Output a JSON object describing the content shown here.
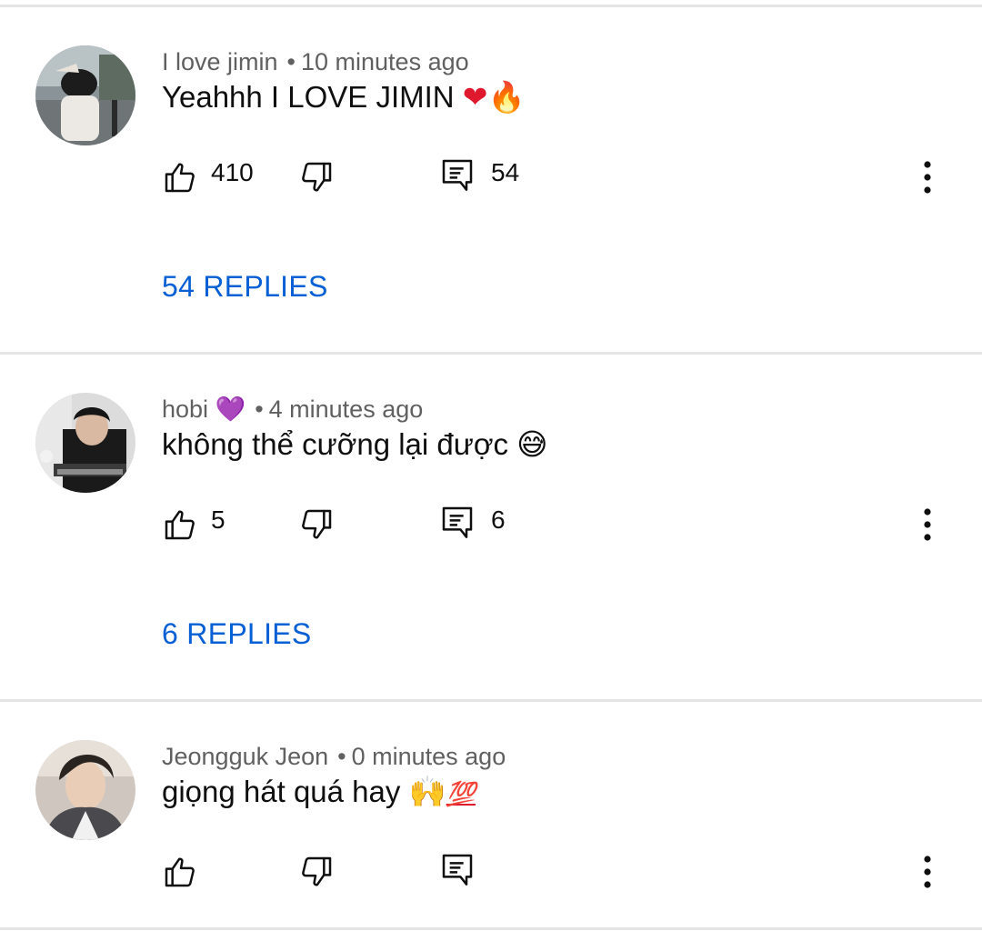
{
  "comments": [
    {
      "author": "I love jimin",
      "separator": "•",
      "time": "10 minutes ago",
      "text": "Yeahhh I LOVE JIMIN",
      "text_emoji_1": "❤",
      "text_emoji_2": "🔥",
      "likes": "410",
      "replies_count": "54",
      "replies_label": "54 REPLIES",
      "like_icon": "thumbs-up-icon",
      "dislike_icon": "thumbs-down-icon",
      "reply_icon": "comment-reply-icon",
      "more_icon": "more-vert-icon"
    },
    {
      "author": "hobi",
      "author_emoji": "💜",
      "separator": "•",
      "time": "4 minutes ago",
      "text": "không thể cưỡng lại được",
      "text_emoji_1": "😅",
      "likes": "5",
      "replies_count": "6",
      "replies_label": "6 REPLIES"
    },
    {
      "author": "Jeongguk Jeon",
      "separator": "•",
      "time": "0 minutes ago",
      "text": "giọng hát quá hay",
      "text_emoji_1": "🙌",
      "text_emoji_2": "💯"
    }
  ],
  "colors": {
    "replies_link": "#065fd4",
    "meta_text": "#606060",
    "divider": "#e5e5e5"
  }
}
